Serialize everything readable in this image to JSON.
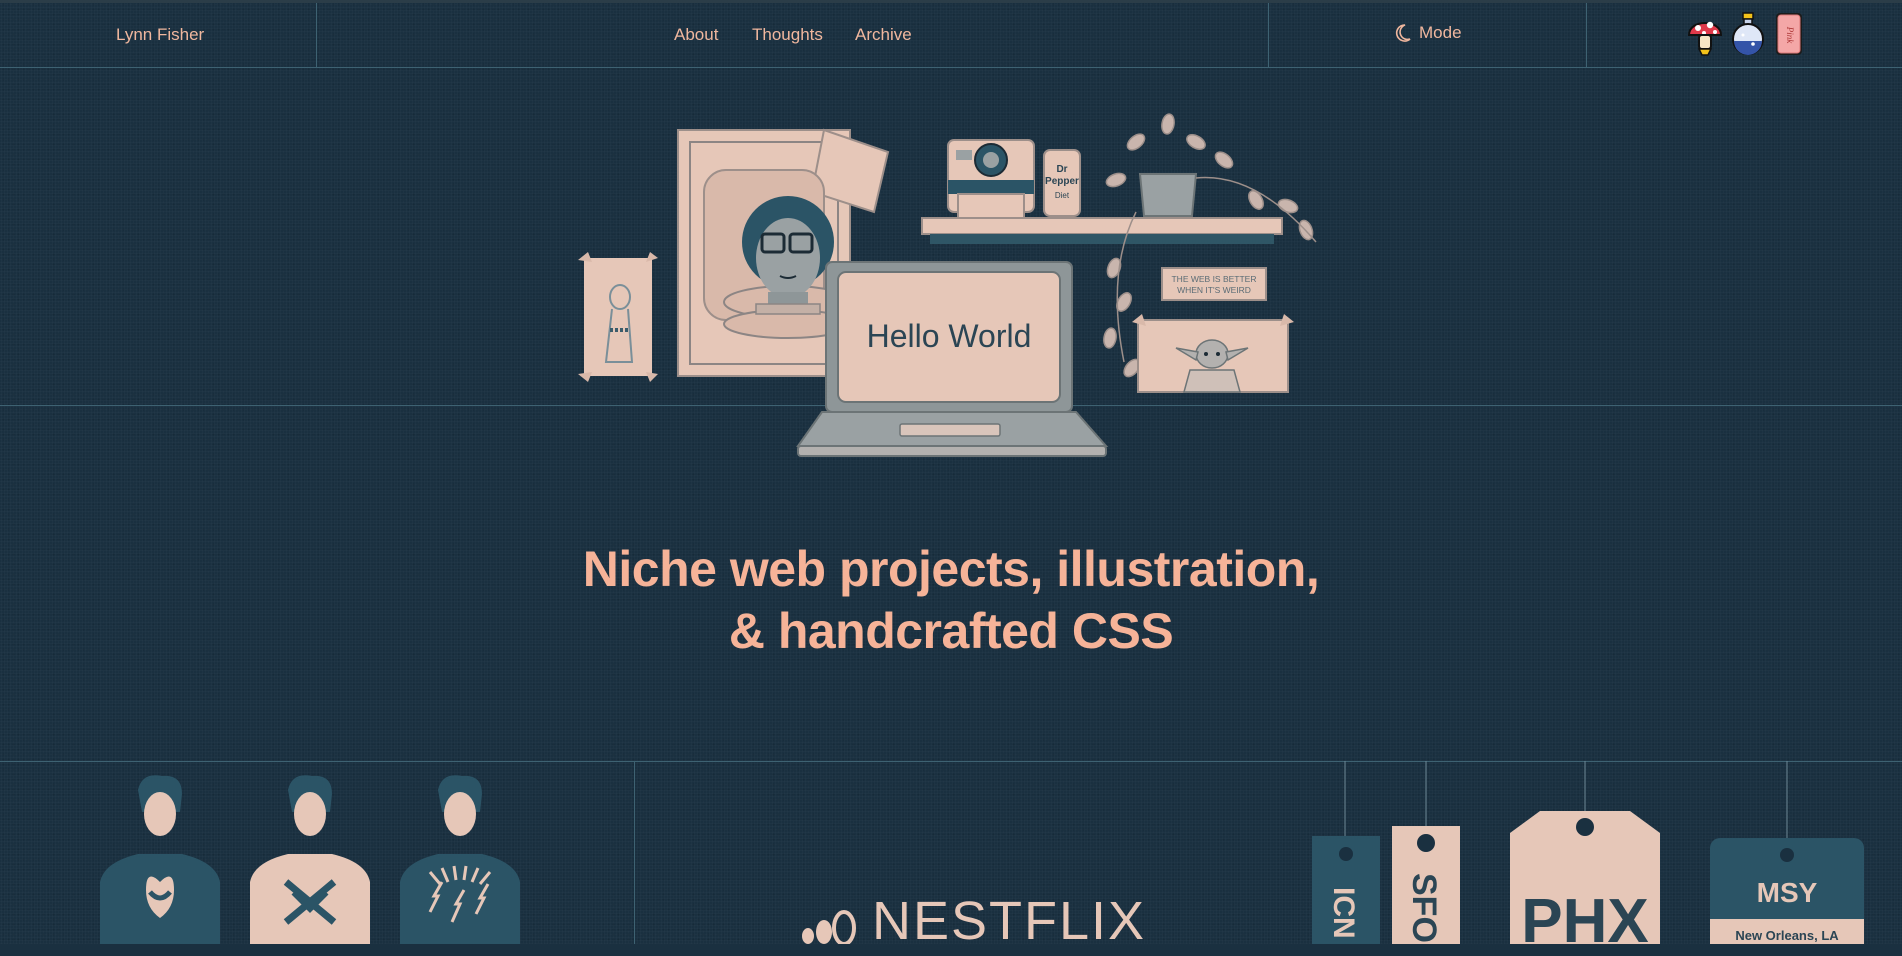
{
  "header": {
    "brand": "Lynn Fisher",
    "nav": [
      {
        "label": "About"
      },
      {
        "label": "Thoughts"
      },
      {
        "label": "Archive"
      }
    ],
    "mode_label": "Mode",
    "badges": [
      "mushroom-badge",
      "potion-badge",
      "pink-badge"
    ],
    "pink_badge_text": "Pink"
  },
  "hero": {
    "laptop_text": "Hello World",
    "sign_text_line1": "THE WEB IS BETTER",
    "sign_text_line2": "WHEN IT'S WEIRD",
    "can_text_line1": "Dr",
    "can_text_line2": "Pepper",
    "can_text_line3": "Diet",
    "headline_line1": "Niche web projects, illustration,",
    "headline_line2": "& handcrafted CSS"
  },
  "projects": {
    "nestflix_logo": "NESTFLIX",
    "airport_tags": [
      {
        "code": "ICN"
      },
      {
        "code": "SFO"
      },
      {
        "code": "PHX"
      },
      {
        "code": "MSY",
        "city": "New Orleans, LA"
      }
    ]
  },
  "colors": {
    "background": "#1a3040",
    "accent": "#f6b398",
    "cream": "#e6c7b8",
    "teal": "#2b5466",
    "line": "#3e6272"
  }
}
